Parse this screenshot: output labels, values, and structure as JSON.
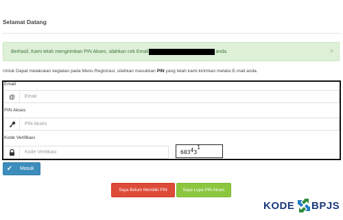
{
  "page": {
    "title": "Selamat Datang"
  },
  "alert": {
    "message_before": "Berhasil, Kami telah mengirimkan PIN Akses, silahkan cek Email",
    "message_after": "anda.",
    "close_symbol": "×",
    "bg_color": "#dff0d8",
    "text_color": "#3c763d"
  },
  "instruction": {
    "part1": "Untuk Dapat melakukan kegiatan pada Menu Registrasi, silahkan masukkan",
    "bold": "PIN",
    "part2": "yang telah kami kirimkan melalui E-mail anda."
  },
  "form": {
    "email": {
      "label": "Email",
      "placeholder": "Email",
      "value": "",
      "icon": "at-icon",
      "icon_glyph": "@"
    },
    "pin": {
      "label": "PIN Akses",
      "placeholder": "PIN Akses",
      "value": "",
      "icon": "key-icon"
    },
    "code": {
      "label": "Kode Verifikasi",
      "placeholder": "Kode Verifikasi",
      "value": "",
      "icon": "lock-icon"
    },
    "captcha": {
      "c1": "6",
      "c2": "0",
      "c3": "3",
      "c4": "4",
      "c5": "3",
      "c6": "1"
    }
  },
  "buttons": {
    "masuk": "Masuk",
    "no_pin": "Saya Belum Memiliki PIN",
    "forgot_pin": "Saya Lupa PIN Akses"
  },
  "colors": {
    "primary": "#3c8dbc",
    "danger": "#dd4b39",
    "success": "#8cc63f"
  },
  "logo": {
    "left": "KODE",
    "right": "BPJS"
  }
}
